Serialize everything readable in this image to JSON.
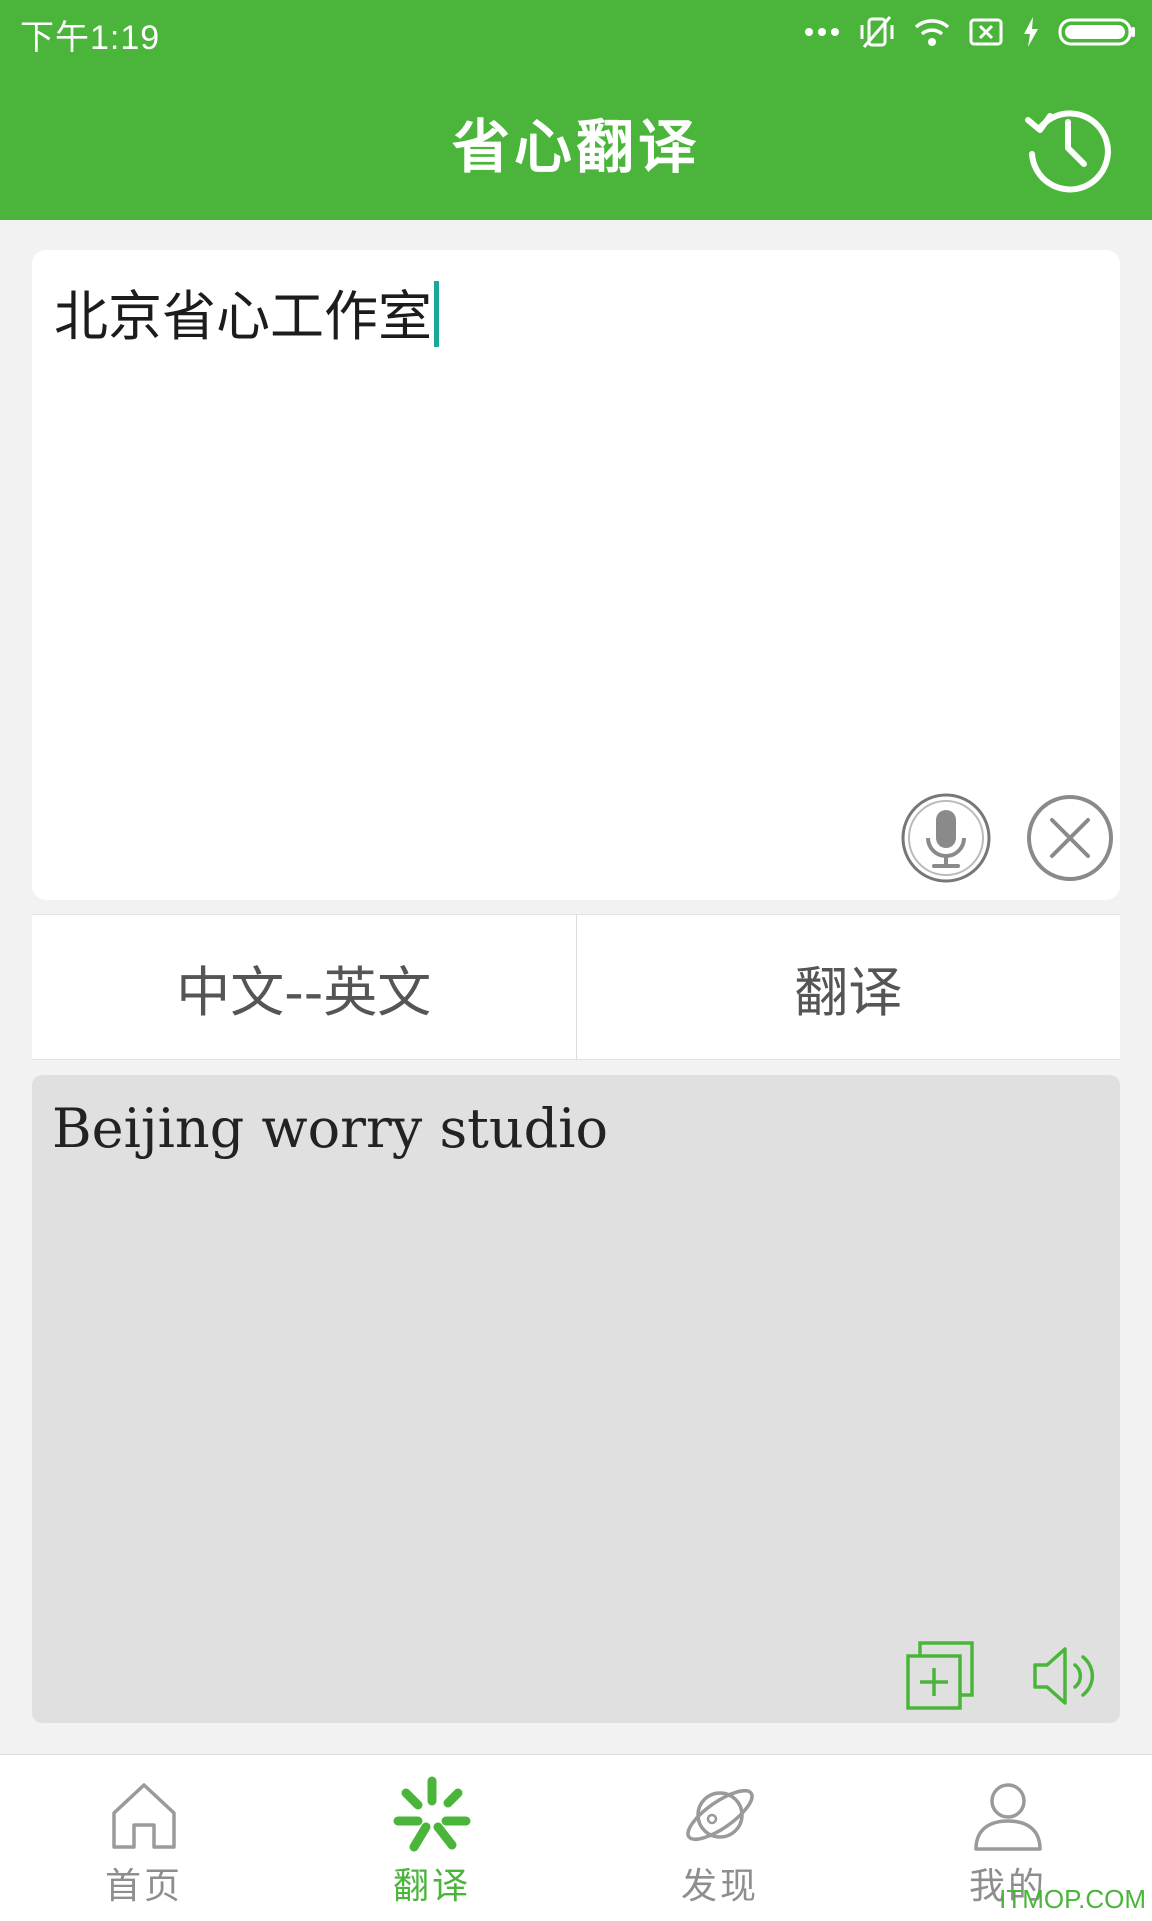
{
  "status_bar": {
    "time": "下午1:19"
  },
  "header": {
    "title": "省心翻译",
    "history_icon": "history-icon"
  },
  "input": {
    "text": "北京省心工作室",
    "mic_icon": "microphone-icon",
    "clear_icon": "close-circle-icon"
  },
  "actions": {
    "language_pair": "中文--英文",
    "translate_label": "翻译"
  },
  "output": {
    "text": "Beijing worry studio",
    "copy_icon": "copy-icon",
    "speak_icon": "speaker-icon"
  },
  "bottom_nav": {
    "items": [
      {
        "label": "首页",
        "icon": "home-icon",
        "active": false
      },
      {
        "label": "翻译",
        "icon": "translate-icon",
        "active": true
      },
      {
        "label": "发现",
        "icon": "planet-icon",
        "active": false
      },
      {
        "label": "我的",
        "icon": "user-icon",
        "active": false
      }
    ]
  },
  "watermark": "ITMOP.COM",
  "colors": {
    "brand_green": "#4bb53b",
    "caret": "#1aa89a",
    "output_bg": "#e0e0e0",
    "nav_inactive": "#8e8e8e"
  }
}
